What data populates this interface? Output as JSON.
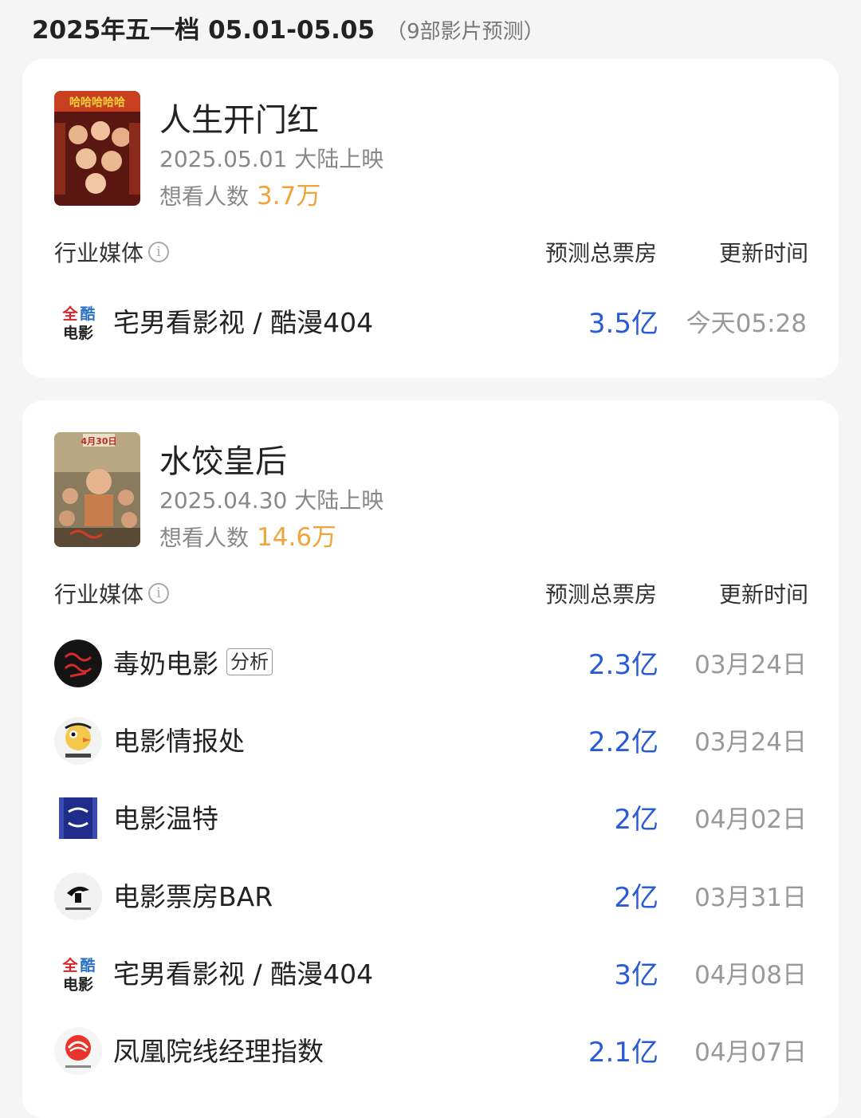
{
  "header": {
    "title": "2025年五一档 05.01-05.05",
    "subtitle": "（9部影片预测）"
  },
  "table_headers": {
    "media": "行业媒体",
    "forecast": "预测总票房",
    "updated": "更新时间"
  },
  "movies": [
    {
      "title": "人生开门红",
      "release": "2025.05.01 大陆上映",
      "want_label": "想看人数",
      "want_count": "3.7万",
      "poster_text": "哈哈哈哈哈",
      "forecasts": [
        {
          "media": "宅男看影视 / 酷漫404",
          "logo": "quanku-logo",
          "tag": "",
          "box_office": "3.5亿",
          "updated": "今天05:28"
        }
      ]
    },
    {
      "title": "水饺皇后",
      "release": "2025.04.30 大陆上映",
      "want_label": "想看人数",
      "want_count": "14.6万",
      "poster_text": "4月30日",
      "forecasts": [
        {
          "media": "毒奶电影",
          "logo": "dunai-logo",
          "tag": "分析",
          "box_office": "2.3亿",
          "updated": "03月24日"
        },
        {
          "media": "电影情报处",
          "logo": "qingbao-logo",
          "tag": "",
          "box_office": "2.2亿",
          "updated": "03月24日"
        },
        {
          "media": "电影温特",
          "logo": "wente-logo",
          "tag": "",
          "box_office": "2亿",
          "updated": "04月02日"
        },
        {
          "media": "电影票房BAR",
          "logo": "piaofang-bar-logo",
          "tag": "",
          "box_office": "2亿",
          "updated": "03月31日"
        },
        {
          "media": "宅男看影视 / 酷漫404",
          "logo": "quanku-logo",
          "tag": "",
          "box_office": "3亿",
          "updated": "04月08日"
        },
        {
          "media": "凤凰院线经理指数",
          "logo": "ifeng-logo",
          "tag": "",
          "box_office": "2.1亿",
          "updated": "04月07日"
        }
      ]
    }
  ],
  "colors": {
    "accent_blue": "#2a5bd7",
    "want_orange": "#f0a43a",
    "card_bg": "#ffffff",
    "page_bg": "#f5f5f5"
  }
}
